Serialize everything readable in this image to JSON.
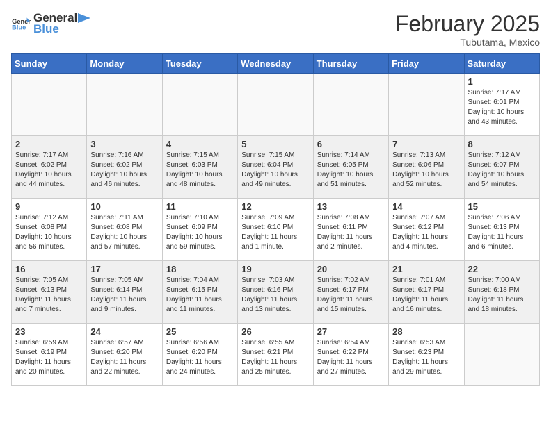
{
  "header": {
    "logo": {
      "general": "General",
      "blue": "Blue"
    },
    "title": "February 2025",
    "location": "Tubutama, Mexico"
  },
  "weekdays": [
    "Sunday",
    "Monday",
    "Tuesday",
    "Wednesday",
    "Thursday",
    "Friday",
    "Saturday"
  ],
  "weeks": [
    [
      {
        "day": "",
        "info": ""
      },
      {
        "day": "",
        "info": ""
      },
      {
        "day": "",
        "info": ""
      },
      {
        "day": "",
        "info": ""
      },
      {
        "day": "",
        "info": ""
      },
      {
        "day": "",
        "info": ""
      },
      {
        "day": "1",
        "info": "Sunrise: 7:17 AM\nSunset: 6:01 PM\nDaylight: 10 hours and 43 minutes."
      }
    ],
    [
      {
        "day": "2",
        "info": "Sunrise: 7:17 AM\nSunset: 6:02 PM\nDaylight: 10 hours and 44 minutes."
      },
      {
        "day": "3",
        "info": "Sunrise: 7:16 AM\nSunset: 6:02 PM\nDaylight: 10 hours and 46 minutes."
      },
      {
        "day": "4",
        "info": "Sunrise: 7:15 AM\nSunset: 6:03 PM\nDaylight: 10 hours and 48 minutes."
      },
      {
        "day": "5",
        "info": "Sunrise: 7:15 AM\nSunset: 6:04 PM\nDaylight: 10 hours and 49 minutes."
      },
      {
        "day": "6",
        "info": "Sunrise: 7:14 AM\nSunset: 6:05 PM\nDaylight: 10 hours and 51 minutes."
      },
      {
        "day": "7",
        "info": "Sunrise: 7:13 AM\nSunset: 6:06 PM\nDaylight: 10 hours and 52 minutes."
      },
      {
        "day": "8",
        "info": "Sunrise: 7:12 AM\nSunset: 6:07 PM\nDaylight: 10 hours and 54 minutes."
      }
    ],
    [
      {
        "day": "9",
        "info": "Sunrise: 7:12 AM\nSunset: 6:08 PM\nDaylight: 10 hours and 56 minutes."
      },
      {
        "day": "10",
        "info": "Sunrise: 7:11 AM\nSunset: 6:08 PM\nDaylight: 10 hours and 57 minutes."
      },
      {
        "day": "11",
        "info": "Sunrise: 7:10 AM\nSunset: 6:09 PM\nDaylight: 10 hours and 59 minutes."
      },
      {
        "day": "12",
        "info": "Sunrise: 7:09 AM\nSunset: 6:10 PM\nDaylight: 11 hours and 1 minute."
      },
      {
        "day": "13",
        "info": "Sunrise: 7:08 AM\nSunset: 6:11 PM\nDaylight: 11 hours and 2 minutes."
      },
      {
        "day": "14",
        "info": "Sunrise: 7:07 AM\nSunset: 6:12 PM\nDaylight: 11 hours and 4 minutes."
      },
      {
        "day": "15",
        "info": "Sunrise: 7:06 AM\nSunset: 6:13 PM\nDaylight: 11 hours and 6 minutes."
      }
    ],
    [
      {
        "day": "16",
        "info": "Sunrise: 7:05 AM\nSunset: 6:13 PM\nDaylight: 11 hours and 7 minutes."
      },
      {
        "day": "17",
        "info": "Sunrise: 7:05 AM\nSunset: 6:14 PM\nDaylight: 11 hours and 9 minutes."
      },
      {
        "day": "18",
        "info": "Sunrise: 7:04 AM\nSunset: 6:15 PM\nDaylight: 11 hours and 11 minutes."
      },
      {
        "day": "19",
        "info": "Sunrise: 7:03 AM\nSunset: 6:16 PM\nDaylight: 11 hours and 13 minutes."
      },
      {
        "day": "20",
        "info": "Sunrise: 7:02 AM\nSunset: 6:17 PM\nDaylight: 11 hours and 15 minutes."
      },
      {
        "day": "21",
        "info": "Sunrise: 7:01 AM\nSunset: 6:17 PM\nDaylight: 11 hours and 16 minutes."
      },
      {
        "day": "22",
        "info": "Sunrise: 7:00 AM\nSunset: 6:18 PM\nDaylight: 11 hours and 18 minutes."
      }
    ],
    [
      {
        "day": "23",
        "info": "Sunrise: 6:59 AM\nSunset: 6:19 PM\nDaylight: 11 hours and 20 minutes."
      },
      {
        "day": "24",
        "info": "Sunrise: 6:57 AM\nSunset: 6:20 PM\nDaylight: 11 hours and 22 minutes."
      },
      {
        "day": "25",
        "info": "Sunrise: 6:56 AM\nSunset: 6:20 PM\nDaylight: 11 hours and 24 minutes."
      },
      {
        "day": "26",
        "info": "Sunrise: 6:55 AM\nSunset: 6:21 PM\nDaylight: 11 hours and 25 minutes."
      },
      {
        "day": "27",
        "info": "Sunrise: 6:54 AM\nSunset: 6:22 PM\nDaylight: 11 hours and 27 minutes."
      },
      {
        "day": "28",
        "info": "Sunrise: 6:53 AM\nSunset: 6:23 PM\nDaylight: 11 hours and 29 minutes."
      },
      {
        "day": "",
        "info": ""
      }
    ]
  ]
}
